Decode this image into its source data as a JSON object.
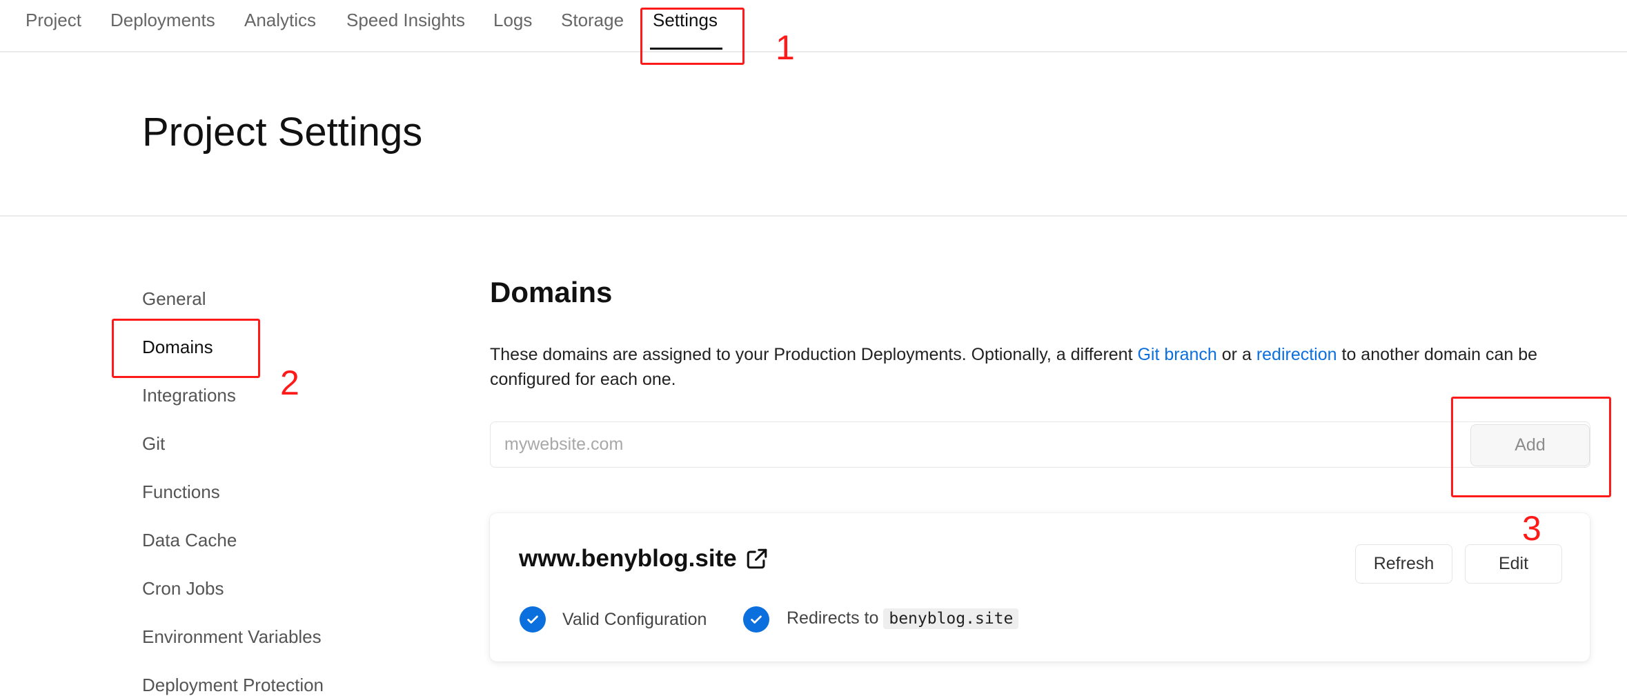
{
  "nav": {
    "tabs": [
      {
        "label": "Project"
      },
      {
        "label": "Deployments"
      },
      {
        "label": "Analytics"
      },
      {
        "label": "Speed Insights"
      },
      {
        "label": "Logs"
      },
      {
        "label": "Storage"
      },
      {
        "label": "Settings",
        "active": true
      }
    ]
  },
  "page": {
    "title": "Project Settings"
  },
  "sidebar": {
    "items": [
      {
        "label": "General"
      },
      {
        "label": "Domains",
        "active": true
      },
      {
        "label": "Integrations"
      },
      {
        "label": "Git"
      },
      {
        "label": "Functions"
      },
      {
        "label": "Data Cache"
      },
      {
        "label": "Cron Jobs"
      },
      {
        "label": "Environment Variables"
      },
      {
        "label": "Deployment Protection"
      }
    ]
  },
  "domains": {
    "title": "Domains",
    "description_part1": "These domains are assigned to your Production Deployments. Optionally, a different ",
    "link_git_branch": "Git branch",
    "description_part2": " or a ",
    "link_redirection": "redirection",
    "description_part3": " to another domain can be configured for each one.",
    "input_placeholder": "mywebsite.com",
    "add_label": "Add",
    "card": {
      "domain": "www.benyblog.site",
      "refresh_label": "Refresh",
      "edit_label": "Edit",
      "status_valid": "Valid Configuration",
      "redirect_prefix": "Redirects to",
      "redirect_target": "benyblog.site"
    }
  },
  "annotations": {
    "step1": "1",
    "step2": "2",
    "step3": "3"
  },
  "colors": {
    "accent": "#0b6fde",
    "annotation": "#ff1a1a"
  }
}
